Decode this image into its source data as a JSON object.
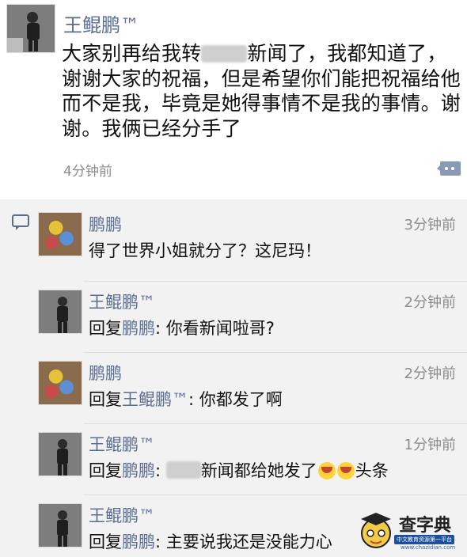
{
  "post": {
    "author": "王鲲鹏™",
    "text_before_blur": "大家别再给我转",
    "text_after_blur": "新闻了，我都知道了，谢谢大家的祝福，但是希望你们能把祝福给他而不是我，毕竟是她得事情不是我的事情。谢谢。我俩已经分手了",
    "time": "4分钟前"
  },
  "comments": [
    {
      "author": "鹏鹏",
      "time": "3分钟前",
      "text": "得了世界小姐就分了？这尼玛！"
    },
    {
      "author": "王鲲鹏™",
      "time": "2分钟前",
      "reply_prefix": "回复",
      "reply_to": "鹏鹏",
      "text": ": 你看新闻啦哥?"
    },
    {
      "author": "鹏鹏",
      "time": "2分钟前",
      "reply_prefix": "回复",
      "reply_to": "王鲲鹏™",
      "text": ": 你都发了啊"
    },
    {
      "author": "王鲲鹏™",
      "time": "1分钟前",
      "reply_prefix": "回复",
      "reply_to": "鹏鹏",
      "text_before_blur": ": ",
      "text_after_blur": "新闻都给她发了",
      "text_end": "头条"
    },
    {
      "author": "王鲲鹏™",
      "reply_prefix": "回复",
      "reply_to": "鹏鹏",
      "text": ": 主要说我还是没能力心"
    }
  ],
  "watermark": {
    "name": "查字典",
    "slogan": "中文教育资源第一平台",
    "url": "www.chazidian.com"
  },
  "colors": {
    "name_link": "#5a6d93",
    "comments_bg": "#f2f2f2",
    "time": "#8c8c8c"
  },
  "icons": [
    "comment-bubble-icon",
    "comment-section-icon",
    "laugh-cry-emoji",
    "scholar-mascot-icon"
  ]
}
